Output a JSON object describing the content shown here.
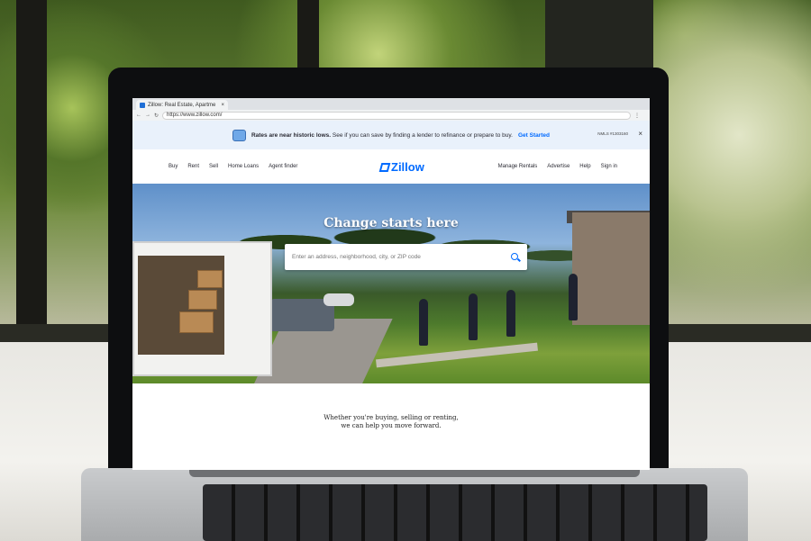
{
  "browser": {
    "tab_title": "Zillow: Real Estate, Apartme",
    "tab_close": "×",
    "url": "https://www.zillow.com/"
  },
  "banner": {
    "lead": "Rates are near historic lows.",
    "text": "See if you can save by finding a lender to refinance or prepare to buy.",
    "cta": "Get Started",
    "nmls": "NMLS #1303160",
    "close": "×"
  },
  "nav": {
    "left": [
      "Buy",
      "Rent",
      "Sell",
      "Home Loans",
      "Agent finder"
    ],
    "logo": "Zillow",
    "right": [
      "Manage Rentals",
      "Advertise",
      "Help",
      "Sign in"
    ]
  },
  "hero": {
    "title": "Change starts here",
    "search_placeholder": "Enter an address, neighborhood, city, or ZIP code"
  },
  "tagline": {
    "line1": "Whether you're buying, selling or renting,",
    "line2": "we can help you move forward."
  },
  "colors": {
    "brand": "#006aff",
    "banner_bg": "#e9f1fb"
  }
}
